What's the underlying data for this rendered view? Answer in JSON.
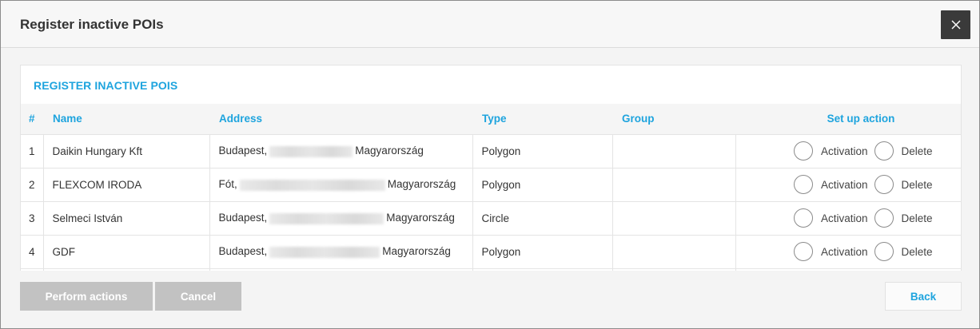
{
  "dialog": {
    "title": "Register inactive POIs",
    "close_icon": "close-icon"
  },
  "panel": {
    "title": "REGISTER INACTIVE POIS"
  },
  "table": {
    "headers": {
      "num": "#",
      "name": "Name",
      "address": "Address",
      "type": "Type",
      "group": "Group",
      "action": "Set up action"
    },
    "rows": [
      {
        "num": "1",
        "name": "Daikin Hungary Kft",
        "city": "Budapest,",
        "country": "Magyarország",
        "type": "Polygon",
        "group": ""
      },
      {
        "num": "2",
        "name": "FLEXCOM IRODA",
        "city": "Fót,",
        "country": "Magyarország",
        "type": "Polygon",
        "group": ""
      },
      {
        "num": "3",
        "name": "Selmeci István",
        "city": "Budapest,",
        "country": "Magyarország",
        "type": "Circle",
        "group": ""
      },
      {
        "num": "4",
        "name": "GDF",
        "city": "Budapest,",
        "country": "Magyarország",
        "type": "Polygon",
        "group": ""
      }
    ],
    "action_labels": {
      "activation": "Activation",
      "delete": "Delete"
    }
  },
  "footer": {
    "perform_label": "Perform actions",
    "cancel_label": "Cancel",
    "back_label": "Back"
  },
  "colors": {
    "accent": "#1ea4de",
    "close_bg": "#3a3a3a",
    "disabled_btn": "#c2c2c2"
  }
}
